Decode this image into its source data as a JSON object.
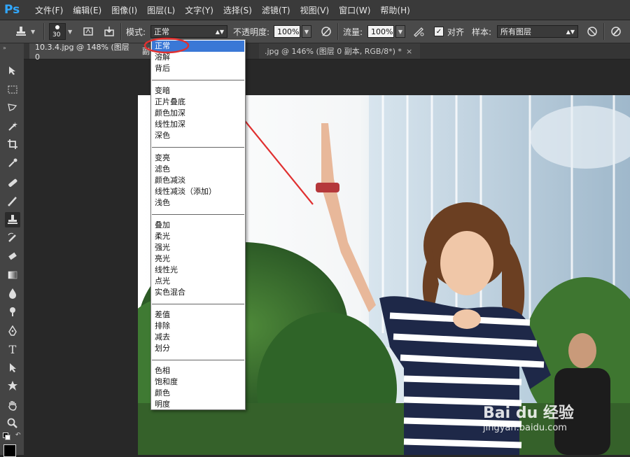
{
  "app": {
    "logo": "Ps"
  },
  "menu": [
    "文件(F)",
    "编辑(E)",
    "图像(I)",
    "图层(L)",
    "文字(Y)",
    "选择(S)",
    "滤镜(T)",
    "视图(V)",
    "窗口(W)",
    "帮助(H)"
  ],
  "options": {
    "brush_size": "30",
    "mode_label": "模式:",
    "mode_value": "正常",
    "opacity_label": "不透明度:",
    "opacity_value": "100%",
    "flow_label": "流量:",
    "flow_value": "100%",
    "align_label": "对齐",
    "align_checked": true,
    "sample_label": "样本:",
    "sample_value": "所有图层"
  },
  "tabs": [
    {
      "label": "10.3.4.jpg @ 148% (图层 0",
      "extra": "副"
    },
    {
      "label": ".jpg @ 146% (图层 0 副本, RGB/8*) *",
      "close": "×"
    }
  ],
  "blend_modes": {
    "groups": [
      [
        "正常",
        "溶解",
        "背后"
      ],
      [
        "变暗",
        "正片叠底",
        "颜色加深",
        "线性加深",
        "深色"
      ],
      [
        "变亮",
        "滤色",
        "颜色减淡",
        "线性减淡（添加）",
        "浅色"
      ],
      [
        "叠加",
        "柔光",
        "强光",
        "亮光",
        "线性光",
        "点光",
        "实色混合"
      ],
      [
        "差值",
        "排除",
        "减去",
        "划分"
      ],
      [
        "色相",
        "饱和度",
        "颜色",
        "明度"
      ]
    ],
    "selected": "正常"
  },
  "watermark": {
    "line1": "Bai du 经验",
    "line2": "jingyan.baidu.com"
  },
  "colors": {
    "accent": "#3a78d6",
    "annotation": "#e03030",
    "logo": "#31a8ff"
  }
}
